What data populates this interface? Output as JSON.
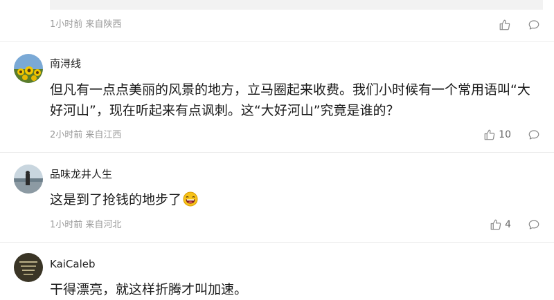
{
  "comments": [
    {
      "meta": "1小时前 来自陕西",
      "like_count": ""
    },
    {
      "user": "南浔线",
      "content": "但凡有一点点美丽的风景的地方，立马圈起来收费。我们小时候有一个常用语叫“大好河山”，现在听起来有点讽刺。这“大好河山”究竟是谁的？",
      "meta": "2小时前 来自江西",
      "like_count": "10"
    },
    {
      "user": "品味龙井人生",
      "content": "这是到了抢钱的地步了",
      "emoji": "laughing-emoji",
      "meta": "1小时前 来自河北",
      "like_count": "4"
    },
    {
      "user": "KaiCaleb",
      "content": "干得漂亮，就这样折腾才叫加速。"
    }
  ],
  "icons": {
    "like": "thumb-up-icon",
    "reply": "comment-bubble-icon"
  },
  "colors": {
    "meta": "#999999",
    "divider": "#ececec",
    "text": "#1a1a1a"
  }
}
